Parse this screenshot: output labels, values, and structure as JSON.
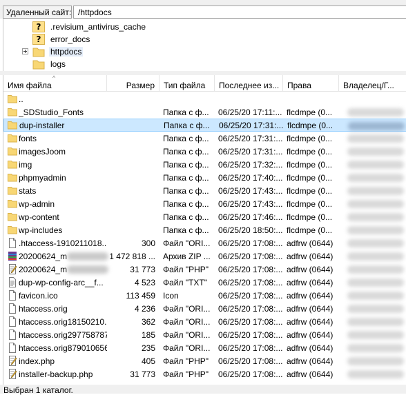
{
  "remote_site": {
    "label": "Удаленный сайт:",
    "path": "/httpdocs"
  },
  "tree": {
    "items": [
      {
        "label": ".revisium_antivirus_cache",
        "icon": "question-folder-icon"
      },
      {
        "label": "error_docs",
        "icon": "question-folder-icon"
      },
      {
        "label": "httpdocs",
        "icon": "folder-icon",
        "selected": true,
        "expandable": true
      },
      {
        "label": "logs",
        "icon": "folder-icon"
      }
    ]
  },
  "columns": {
    "name": "Имя файла",
    "size": "Размер",
    "type": "Тип файла",
    "modified": "Последнее из...",
    "perms": "Права",
    "owner": "Владелец/Г..."
  },
  "files": [
    {
      "name": "..",
      "size": "",
      "type": "",
      "modified": "",
      "perms": "",
      "icon": "folder-icon",
      "owner_blur": false
    },
    {
      "name": "_SDStudio_Fonts",
      "size": "",
      "type": "Папка с ф...",
      "modified": "06/25/20 17:11:...",
      "perms": "flcdmpe (0...",
      "icon": "folder-icon",
      "owner_blur": true
    },
    {
      "name": "dup-installer",
      "size": "",
      "type": "Папка с ф...",
      "modified": "06/25/20 17:31:...",
      "perms": "flcdmpe (0...",
      "icon": "folder-icon",
      "owner_blur": true,
      "selected": true
    },
    {
      "name": "fonts",
      "size": "",
      "type": "Папка с ф...",
      "modified": "06/25/20 17:31:...",
      "perms": "flcdmpe (0...",
      "icon": "folder-icon",
      "owner_blur": true
    },
    {
      "name": "imagesJoom",
      "size": "",
      "type": "Папка с ф...",
      "modified": "06/25/20 17:31:...",
      "perms": "flcdmpe (0...",
      "icon": "folder-icon",
      "owner_blur": true
    },
    {
      "name": "img",
      "size": "",
      "type": "Папка с ф...",
      "modified": "06/25/20 17:32:...",
      "perms": "flcdmpe (0...",
      "icon": "folder-icon",
      "owner_blur": true
    },
    {
      "name": "phpmyadmin",
      "size": "",
      "type": "Папка с ф...",
      "modified": "06/25/20 17:40:...",
      "perms": "flcdmpe (0...",
      "icon": "folder-icon",
      "owner_blur": true
    },
    {
      "name": "stats",
      "size": "",
      "type": "Папка с ф...",
      "modified": "06/25/20 17:43:...",
      "perms": "flcdmpe (0...",
      "icon": "folder-icon",
      "owner_blur": true
    },
    {
      "name": "wp-admin",
      "size": "",
      "type": "Папка с ф...",
      "modified": "06/25/20 17:43:...",
      "perms": "flcdmpe (0...",
      "icon": "folder-icon",
      "owner_blur": true
    },
    {
      "name": "wp-content",
      "size": "",
      "type": "Папка с ф...",
      "modified": "06/25/20 17:46:...",
      "perms": "flcdmpe (0...",
      "icon": "folder-icon",
      "owner_blur": true
    },
    {
      "name": "wp-includes",
      "size": "",
      "type": "Папка с ф...",
      "modified": "06/25/20 18:50:...",
      "perms": "flcdmpe (0...",
      "icon": "folder-icon",
      "owner_blur": true
    },
    {
      "name": ".htaccess-1910211018...",
      "size": "300",
      "type": "Файл \"ORI...",
      "modified": "06/25/20 17:08:...",
      "perms": "adfrw (0644)",
      "icon": "file-icon",
      "owner_blur": true
    },
    {
      "name": "20200624_m",
      "size": "1 472 818 ...",
      "type": "Архив ZIP ...",
      "modified": "06/25/20 17:08:...",
      "perms": "adfrw (0644)",
      "icon": "zip-archive-icon",
      "owner_blur": true,
      "name_blur": true
    },
    {
      "name": "20200624_m",
      "size": "31 773",
      "type": "Файл \"PHP\"",
      "modified": "06/25/20 17:08:...",
      "perms": "adfrw (0644)",
      "icon": "php-file-icon",
      "owner_blur": true,
      "name_blur": true
    },
    {
      "name": "dup-wp-config-arc__f...",
      "size": "4 523",
      "type": "Файл \"TXT\"",
      "modified": "06/25/20 17:08:...",
      "perms": "adfrw (0644)",
      "icon": "text-file-icon",
      "owner_blur": true
    },
    {
      "name": "favicon.ico",
      "size": "113 459",
      "type": "Icon",
      "modified": "06/25/20 17:08:...",
      "perms": "adfrw (0644)",
      "icon": "file-icon",
      "owner_blur": true
    },
    {
      "name": "htaccess.orig",
      "size": "4 236",
      "type": "Файл \"ORI...",
      "modified": "06/25/20 17:08:...",
      "perms": "adfrw (0644)",
      "icon": "file-icon",
      "owner_blur": true
    },
    {
      "name": "htaccess.orig18150210...",
      "size": "362",
      "type": "Файл \"ORI...",
      "modified": "06/25/20 17:08:...",
      "perms": "adfrw (0644)",
      "icon": "file-icon",
      "owner_blur": true
    },
    {
      "name": "htaccess.orig297758787",
      "size": "185",
      "type": "Файл \"ORI...",
      "modified": "06/25/20 17:08:...",
      "perms": "adfrw (0644)",
      "icon": "file-icon",
      "owner_blur": true
    },
    {
      "name": "htaccess.orig879010656",
      "size": "235",
      "type": "Файл \"ORI...",
      "modified": "06/25/20 17:08:...",
      "perms": "adfrw (0644)",
      "icon": "file-icon",
      "owner_blur": true
    },
    {
      "name": "index.php",
      "size": "405",
      "type": "Файл \"PHP\"",
      "modified": "06/25/20 17:08:...",
      "perms": "adfrw (0644)",
      "icon": "php-file-icon",
      "owner_blur": true
    },
    {
      "name": "installer-backup.php",
      "size": "31 773",
      "type": "Файл \"PHP\"",
      "modified": "06/25/20 17:08:...",
      "perms": "adfrw (0644)",
      "icon": "php-file-icon",
      "owner_blur": true
    }
  ],
  "status": {
    "text": "Выбран 1 каталог."
  },
  "colors": {
    "selection_bg": "#cce8ff",
    "selection_border": "#99d1ff",
    "folder_yellow": "#f8d775",
    "chrome_bg": "#f0f0f0"
  }
}
